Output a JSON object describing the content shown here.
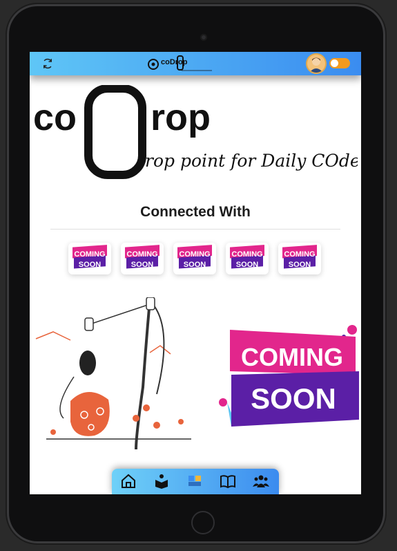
{
  "app": {
    "logo_co": "co",
    "logo_d": "D",
    "logo_rop": "rop",
    "tagline": "rop point for Daily COders"
  },
  "topbar": {
    "refresh_icon": "refresh-icon",
    "mini_logo_text": "coDrop",
    "avatar_icon": "user-avatar",
    "theme_toggle_state": "on"
  },
  "main": {
    "heading": "Connected With",
    "badges": [
      {
        "line1": "COMING",
        "line2": "SOON"
      },
      {
        "line1": "COMING",
        "line2": "SOON"
      },
      {
        "line1": "COMING",
        "line2": "SOON"
      },
      {
        "line1": "COMING",
        "line2": "SOON"
      },
      {
        "line1": "COMING",
        "line2": "SOON"
      }
    ],
    "banner": {
      "line1": "COMING",
      "line2": "SOON"
    }
  },
  "bottom_nav": {
    "items": [
      "home-icon",
      "reader-icon",
      "gallery-icon",
      "book-icon",
      "community-icon"
    ]
  },
  "colors": {
    "accent_start": "#5fc6f6",
    "accent_end": "#3a8cf0",
    "badge_pink": "#e2268c",
    "badge_purple": "#5b1fa6",
    "badge_orange": "#f49225",
    "illustration_orange": "#e8643c"
  }
}
